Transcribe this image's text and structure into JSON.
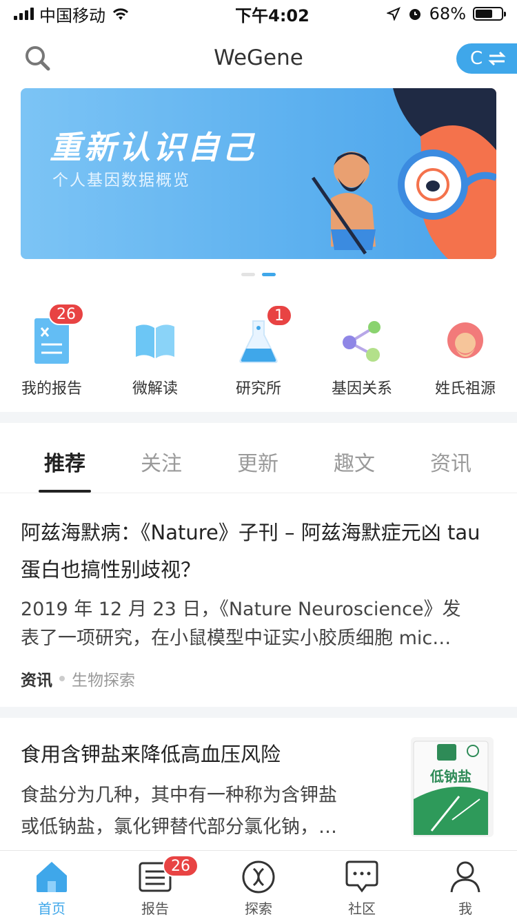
{
  "status": {
    "carrier": "中国移动",
    "time": "下午4:02",
    "battery": "68%",
    "battery_level": 0.68
  },
  "header": {
    "title": "WeGene",
    "switch_label": "C"
  },
  "banner": {
    "title": "重新认识自己",
    "subtitle": "个人基因数据概览",
    "active_page": 2,
    "pages": 2
  },
  "quick": [
    {
      "label": "我的报告",
      "icon": "report-icon",
      "badge": "26"
    },
    {
      "label": "微解读",
      "icon": "book-icon"
    },
    {
      "label": "研究所",
      "icon": "flask-icon",
      "badge": "1"
    },
    {
      "label": "基因关系",
      "icon": "share-network-icon"
    },
    {
      "label": "姓氏祖源",
      "icon": "ancestor-face-icon"
    }
  ],
  "tabs": [
    "推荐",
    "关注",
    "更新",
    "趣文",
    "资讯"
  ],
  "articles": [
    {
      "title": "阿兹海默病：《Nature》子刊 – 阿兹海默症元凶 tau 蛋白也搞性别歧视？",
      "desc_line1": "2019 年 12 月 23 日，《Nature Neuroscience》发",
      "desc_line2": "表了一项研究，在小鼠模型中证实小胶质细胞 mic…",
      "category": "资讯",
      "source": "生物探索"
    },
    {
      "title": "食用含钾盐来降低高血压风险",
      "desc_line1": "食盐分为几种，其中有一种称为含钾盐",
      "desc_line2": "或低钠盐，氯化钾替代部分氯化钠，…",
      "thumb_text": "低钠盐"
    }
  ],
  "tabbar": [
    {
      "label": "首页",
      "icon": "home-icon",
      "active": true
    },
    {
      "label": "报告",
      "icon": "report-list-icon",
      "badge": "26"
    },
    {
      "label": "探索",
      "icon": "dna-explore-icon"
    },
    {
      "label": "社区",
      "icon": "chat-bubble-icon"
    },
    {
      "label": "我",
      "icon": "user-icon"
    }
  ]
}
